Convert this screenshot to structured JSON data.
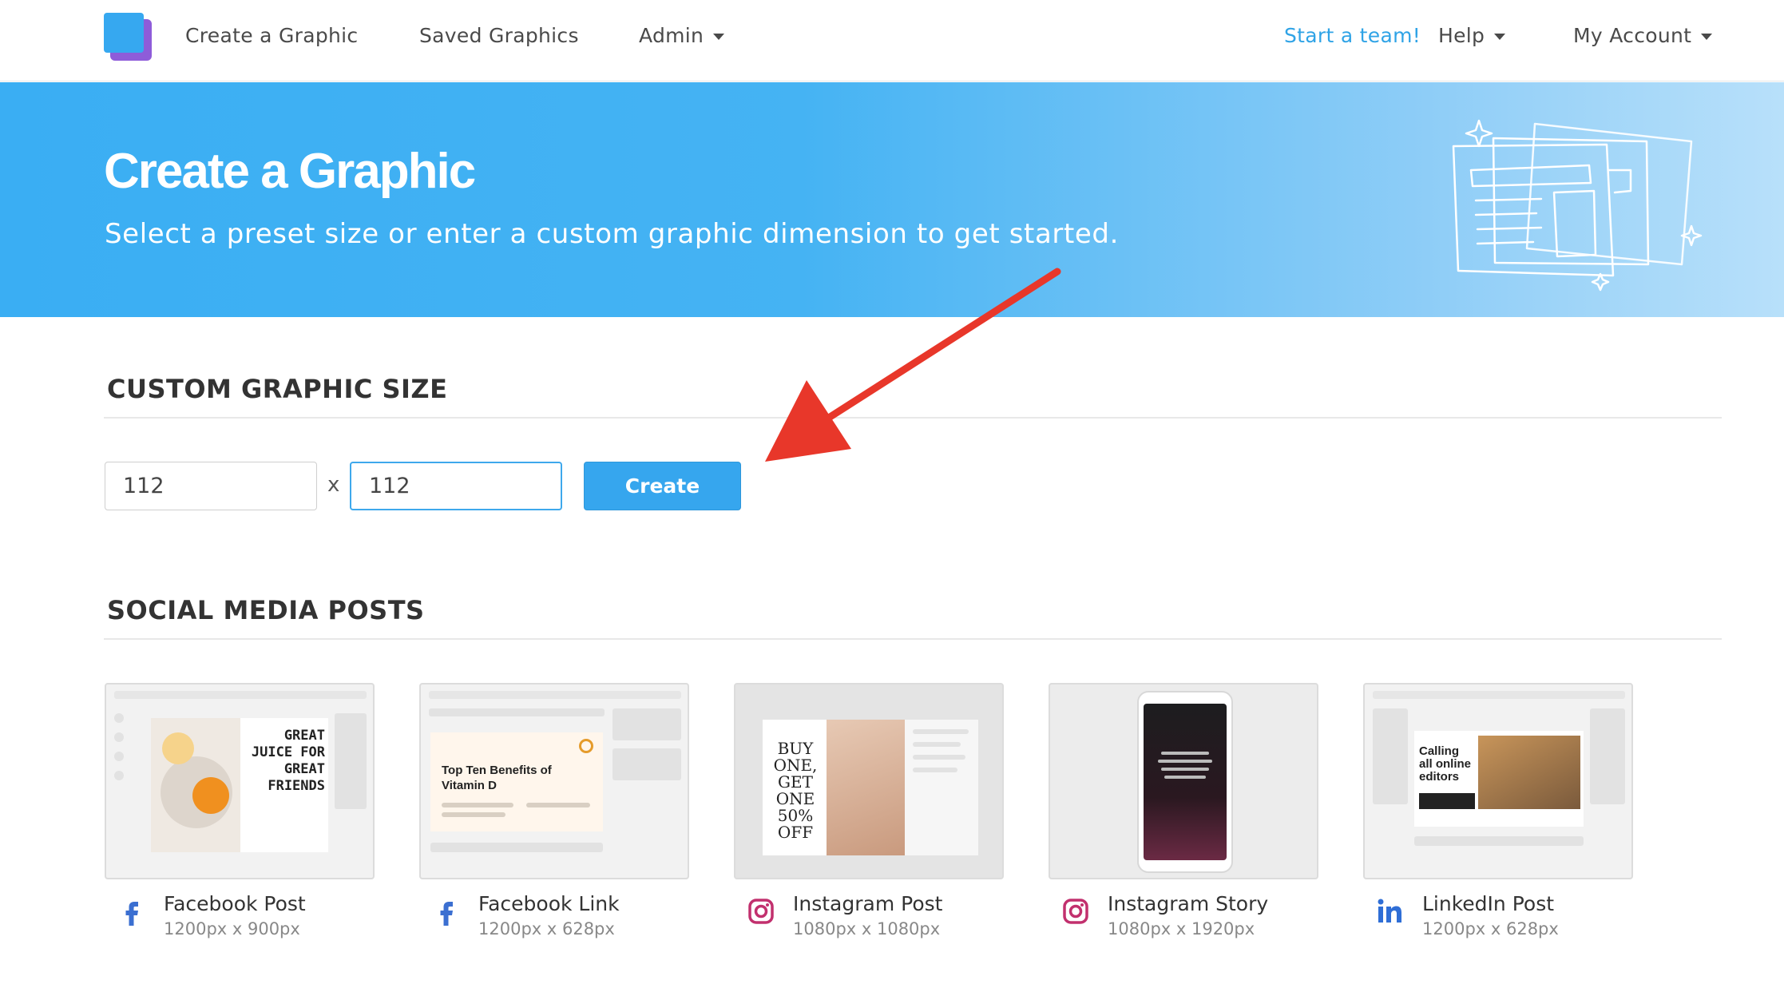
{
  "nav": {
    "create": "Create a Graphic",
    "saved": "Saved Graphics",
    "admin": "Admin",
    "start_team": "Start a team!",
    "help": "Help",
    "account": "My Account"
  },
  "hero": {
    "title": "Create a Graphic",
    "subtitle": "Select a preset size or enter a custom graphic dimension to get started."
  },
  "custom": {
    "heading": "CUSTOM GRAPHIC SIZE",
    "width_value": "112",
    "height_value": "112",
    "separator": "x",
    "create_label": "Create"
  },
  "social": {
    "heading": "SOCIAL MEDIA POSTS",
    "cards": [
      {
        "title": "Facebook Post",
        "size": "1200px x 900px",
        "icon": "facebook-icon"
      },
      {
        "title": "Facebook Link",
        "size": "1200px x 628px",
        "icon": "facebook-icon"
      },
      {
        "title": "Instagram Post",
        "size": "1080px x 1080px",
        "icon": "instagram-icon"
      },
      {
        "title": "Instagram Story",
        "size": "1080px x 1920px",
        "icon": "instagram-icon"
      },
      {
        "title": "LinkedIn Post",
        "size": "1200px x 628px",
        "icon": "linkedin-icon"
      }
    ]
  },
  "thumbnails": {
    "fb_post_text": "GREAT JUICE FOR GREAT FRIENDS",
    "fb_link_text": "Top Ten Benefits of Vitamin D",
    "ig_post_text": "BUY ONE, GET ONE 50% OFF",
    "linkedin_text": "Calling all online editors"
  },
  "colors": {
    "accent": "#36a6ee",
    "hero_start": "#3aaef3",
    "arrow": "#e8372a",
    "facebook": "#3b6fd1",
    "instagram": "#c2306e",
    "linkedin": "#2f6ed6"
  }
}
